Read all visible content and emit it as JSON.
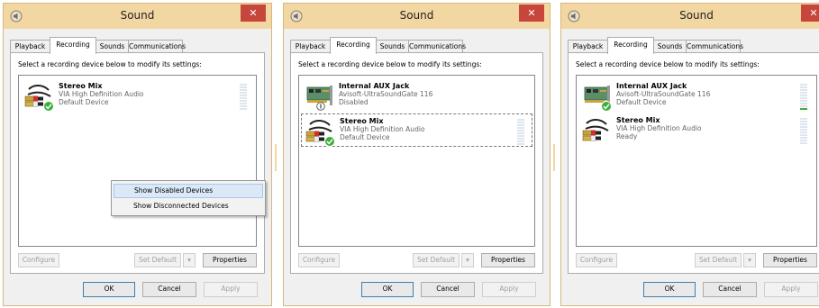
{
  "windows": [
    {
      "title": "Sound",
      "tabs": [
        "Playback",
        "Recording",
        "Sounds",
        "Communications"
      ],
      "active_tab": "Recording",
      "instruction": "Select a recording device below to modify its settings:",
      "devices": [
        {
          "name": "Stereo Mix",
          "driver": "VIA High Definition Audio",
          "status": "Default Device",
          "icon": "stereo-mix-cable-icon",
          "is_default": true,
          "selected": false,
          "level": 0
        }
      ],
      "buttons": {
        "configure": "Configure",
        "set_default": "Set Default",
        "properties": "Properties"
      },
      "dialog_buttons": {
        "ok": "OK",
        "cancel": "Cancel",
        "apply": "Apply"
      },
      "context_menu": [
        "Show Disabled Devices",
        "Show Disconnected Devices"
      ]
    },
    {
      "title": "Sound",
      "tabs": [
        "Playback",
        "Recording",
        "Sounds",
        "Communications"
      ],
      "active_tab": "Recording",
      "instruction": "Select a recording device below to modify its settings:",
      "devices": [
        {
          "name": "Internal AUX Jack",
          "driver": "Avisoft-UltraSoundGate 116",
          "status": "Disabled",
          "icon": "sound-card-icon",
          "is_default": false,
          "selected": false,
          "level": 0
        },
        {
          "name": "Stereo Mix",
          "driver": "VIA High Definition Audio",
          "status": "Default Device",
          "icon": "stereo-mix-cable-icon",
          "is_default": true,
          "selected": true,
          "level": 0
        }
      ],
      "buttons": {
        "configure": "Configure",
        "set_default": "Set Default",
        "properties": "Properties"
      },
      "dialog_buttons": {
        "ok": "OK",
        "cancel": "Cancel",
        "apply": "Apply"
      }
    },
    {
      "title": "Sound",
      "tabs": [
        "Playback",
        "Recording",
        "Sounds",
        "Communications"
      ],
      "active_tab": "Recording",
      "instruction": "Select a recording device below to modify its settings:",
      "devices": [
        {
          "name": "Internal AUX Jack",
          "driver": "Avisoft-UltraSoundGate 116",
          "status": "Default Device",
          "icon": "sound-card-icon",
          "is_default": true,
          "selected": false,
          "level": 0.1
        },
        {
          "name": "Stereo Mix",
          "driver": "VIA High Definition Audio",
          "status": "Ready",
          "icon": "stereo-mix-cable-icon",
          "is_default": false,
          "selected": false,
          "level": 0
        }
      ],
      "buttons": {
        "configure": "Configure",
        "set_default": "Set Default",
        "properties": "Properties"
      },
      "dialog_buttons": {
        "ok": "OK",
        "cancel": "Cancel",
        "apply": "Apply"
      }
    }
  ],
  "colors": {
    "titlebar": "#f3d7a3",
    "close": "#c7463b",
    "check_green": "#3fae3b",
    "meter_green": "#3fae3b",
    "menu_highlight": "#dbe8f7"
  }
}
